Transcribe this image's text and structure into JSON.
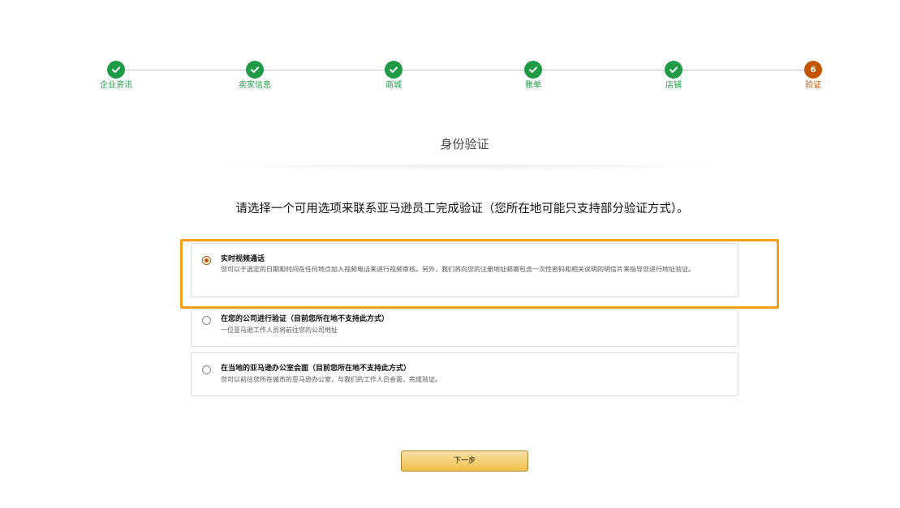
{
  "stepper": {
    "steps": [
      {
        "label": "企业资讯",
        "status": "complete"
      },
      {
        "label": "卖家信息",
        "status": "complete"
      },
      {
        "label": "商城",
        "status": "complete"
      },
      {
        "label": "账单",
        "status": "complete"
      },
      {
        "label": "店铺",
        "status": "complete"
      },
      {
        "label": "验证",
        "status": "current",
        "number": "6"
      }
    ],
    "colors": {
      "complete": "#1f9b46",
      "current": "#c45500"
    }
  },
  "page_title": "身份验证",
  "instruction": "请选择一个可用选项来联系亚马逊员工完成验证（您所在地可能只支持部分验证方式）。",
  "options": [
    {
      "title": "实时视频通话",
      "description": "您可以于选定的日期和时间在任何地点加入视频电话来进行视频审核。另外，我们将向您的注册地址邮寄包含一次性密码和相关说明的明信片来指导您进行地址验证。",
      "selected": true
    },
    {
      "title": "在您的公司进行验证（目前您所在地不支持此方式）",
      "description": "一位亚马逊工作人员将前往您的公司地址",
      "selected": false
    },
    {
      "title": "在当地的亚马逊办公室会面（目前您所在地不支持此方式）",
      "description": "您可以前往您所在城市的亚马逊办公室，与我们的工作人员会面，完成验证。",
      "selected": false
    }
  ],
  "highlight_color": "#f59f1b",
  "next_button_label": "下一步"
}
